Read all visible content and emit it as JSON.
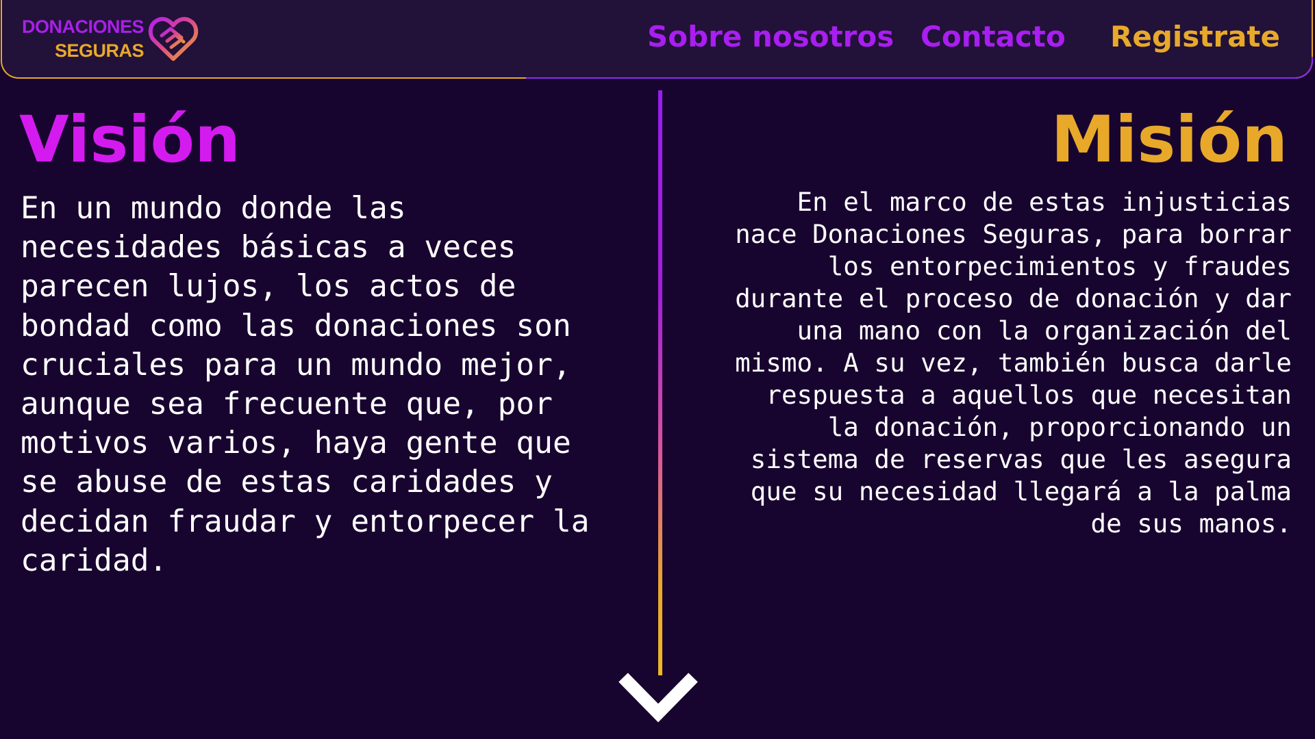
{
  "header": {
    "brand": {
      "line1": "DONACIONES",
      "line2": "SEGURAS",
      "icon": "heart-handshake-icon"
    },
    "nav": {
      "about_label": "Sobre nosotros",
      "contact_label": "Contacto",
      "register_label": "Registrate"
    }
  },
  "vision": {
    "title": "Visión",
    "text": "En un mundo donde las necesidades básicas a veces parecen lujos, los actos de bondad como las donaciones son cruciales para un mundo mejor, aunque sea frecuente que, por motivos varios, haya gente que se abuse de estas caridades y decidan fraudar y entorpecer la caridad."
  },
  "mision": {
    "title": "Misión",
    "text": "En el marco de estas injusticias nace Donaciones Seguras, para borrar los entorpecimientos y fraudes durante el proceso de donación y dar una mano con la organización del mismo. A su vez, también busca darle respuesta a aquellos que necesitan la donación, proporcionando un sistema de reservas que les asegura que su necesidad llegará a la palma de sus manos."
  },
  "scroll_indicator": {
    "icon": "chevron-down-icon"
  },
  "colors": {
    "background": "#18052f",
    "header_background": "#221138",
    "purple_accent": "#a91ef0",
    "magenta_title": "#d41bef",
    "gold_accent": "#e8a92a",
    "text": "#ffffff"
  }
}
